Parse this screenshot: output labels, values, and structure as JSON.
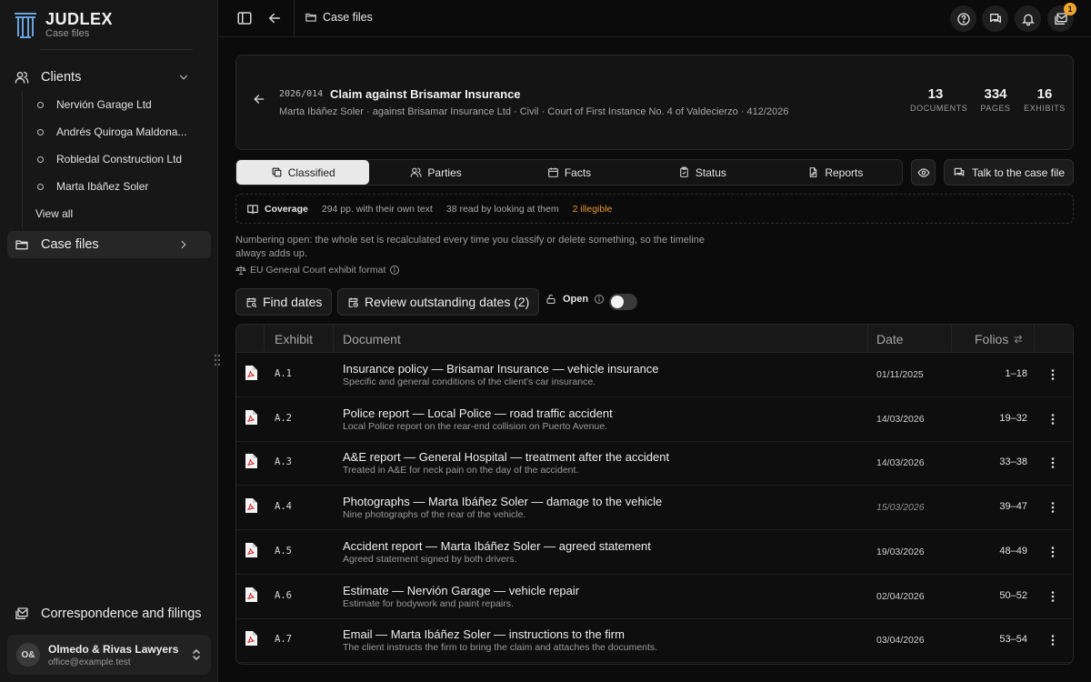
{
  "brand": {
    "name": "JUDLEX",
    "subtitle": "Case files"
  },
  "sidebar": {
    "clients_label": "Clients",
    "clients": [
      "Nervión Garage Ltd",
      "Andrés Quiroga Maldona...",
      "Robledal Construction Ltd",
      "Marta Ibáñez Soler"
    ],
    "view_all": "View all",
    "case_files_label": "Case files",
    "correspondence_label": "Correspondence and filings",
    "account": {
      "initials": "O&",
      "name": "Olmedo & Rivas Lawyers",
      "email": "office@example.test"
    }
  },
  "topbar": {
    "breadcrumb": "Case files",
    "notification_count": "1"
  },
  "case": {
    "number": "2026/014",
    "title": "Claim against Brisamar Insurance",
    "subtitle": "Marta Ibáñez Soler · against Brisamar Insurance Ltd · Civil · Court of First Instance No. 4 of Valdecierzo · 412/2026",
    "stats": [
      {
        "value": "13",
        "label": "DOCUMENTS"
      },
      {
        "value": "334",
        "label": "PAGES"
      },
      {
        "value": "16",
        "label": "EXHIBITS"
      }
    ]
  },
  "tabs": [
    {
      "label": "Classified",
      "icon": "copy-icon"
    },
    {
      "label": "Parties",
      "icon": "users-icon"
    },
    {
      "label": "Facts",
      "icon": "calendar-icon"
    },
    {
      "label": "Status",
      "icon": "clipboard-check-icon"
    },
    {
      "label": "Reports",
      "icon": "file-edit-icon"
    }
  ],
  "active_tab": "Classified",
  "talk_button": "Talk to the case file",
  "coverage": {
    "label": "Coverage",
    "own_text": "294 pp. with their own text",
    "read_by_looking": "38 read by looking at them",
    "illegible": "2 illegible"
  },
  "numbering_note": "Numbering open: the whole set is recalculated every time you classify or delete something, so the timeline always adds up.",
  "exhibit_format": "EU General Court exhibit format",
  "actions": {
    "find_dates": "Find dates",
    "review_dates": "Review outstanding dates (2)",
    "open_label": "Open",
    "open_toggle_on": false
  },
  "table": {
    "columns": {
      "exhibit": "Exhibit",
      "document": "Document",
      "date": "Date",
      "folios": "Folios"
    },
    "rows": [
      {
        "exhibit": "A.1",
        "title": "Insurance policy — Brisamar Insurance — vehicle insurance",
        "subtitle": "Specific and general conditions of the client's car insurance.",
        "date": "01/11/2025",
        "tentative": false,
        "folios": "1–18"
      },
      {
        "exhibit": "A.2",
        "title": "Police report — Local Police — road traffic accident",
        "subtitle": "Local Police report on the rear-end collision on Puerto Avenue.",
        "date": "14/03/2026",
        "tentative": false,
        "folios": "19–32"
      },
      {
        "exhibit": "A.3",
        "title": "A&E report — General Hospital — treatment after the accident",
        "subtitle": "Treated in A&E for neck pain on the day of the accident.",
        "date": "14/03/2026",
        "tentative": false,
        "folios": "33–38"
      },
      {
        "exhibit": "A.4",
        "title": "Photographs — Marta Ibáñez Soler — damage to the vehicle",
        "subtitle": "Nine photographs of the rear of the vehicle.",
        "date": "15/03/2026",
        "tentative": true,
        "folios": "39–47"
      },
      {
        "exhibit": "A.5",
        "title": "Accident report — Marta Ibáñez Soler — agreed statement",
        "subtitle": "Agreed statement signed by both drivers.",
        "date": "19/03/2026",
        "tentative": false,
        "folios": "48–49"
      },
      {
        "exhibit": "A.6",
        "title": "Estimate — Nervión Garage — vehicle repair",
        "subtitle": "Estimate for bodywork and paint repairs.",
        "date": "02/04/2026",
        "tentative": false,
        "folios": "50–52"
      },
      {
        "exhibit": "A.7",
        "title": "Email — Marta Ibáñez Soler — instructions to the firm",
        "subtitle": "The client instructs the firm to bring the claim and attaches the documents.",
        "date": "03/04/2026",
        "tentative": false,
        "folios": "53–54"
      }
    ]
  },
  "colors": {
    "background": "#0b0b0b",
    "sidebar": "#171717",
    "accent_logo": "#6aa4e0",
    "warning": "#e8952f",
    "badge": "#f0a530",
    "pdf_red": "#d8363b"
  }
}
